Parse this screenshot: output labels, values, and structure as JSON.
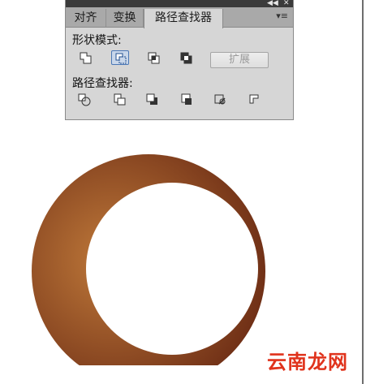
{
  "panel": {
    "tabs": [
      {
        "label": "对齐"
      },
      {
        "label": "变换"
      },
      {
        "label": "路径查找器"
      }
    ],
    "shape_modes_label": "形状模式:",
    "pathfinders_label": "路径查找器:",
    "expand_label": "扩展",
    "topbar": {
      "collapse_glyph": "◀◀",
      "close_glyph": "✕"
    },
    "menu_glyph": "▾≡"
  },
  "artwork": {
    "shape": "crescent",
    "gradient": [
      "#c07a3a",
      "#6b2b14"
    ]
  },
  "watermark": {
    "text": "云南龙网"
  }
}
